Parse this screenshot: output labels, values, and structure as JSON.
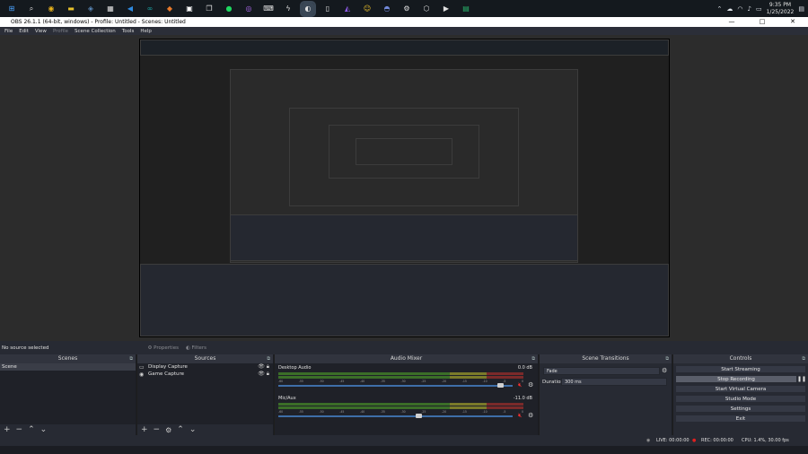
{
  "taskbar": {
    "icons": [
      "windows-icon",
      "search-icon",
      "chrome-icon",
      "file-explorer-icon",
      "steam-icon",
      "files-icon",
      "vscode-icon",
      "arduino-icon",
      "gamepad-icon",
      "notion-icon",
      "copy-icon",
      "spotify-icon",
      "github-icon",
      "keyboard-icon",
      "lightning-icon",
      "obs-icon",
      "notepad-icon",
      "visualstudio-icon",
      "emoji-icon",
      "discord-icon",
      "settings-icon",
      "cube-icon",
      "terminal-icon",
      "app-icon"
    ],
    "time": "9:35 PM",
    "date": "1/25/2022"
  },
  "window": {
    "title": "OBS 26.1.1 (64-bit, windows) - Profile: Untitled - Scenes: Untitled",
    "min": "—",
    "max": "□",
    "close": "✕"
  },
  "menu": [
    "File",
    "Edit",
    "View",
    "Profile",
    "Scene Collection",
    "Tools",
    "Help"
  ],
  "source_toolbar": {
    "status": "No source selected",
    "properties": "Properties",
    "filters": "Filters"
  },
  "scenes": {
    "title": "Scenes",
    "items": [
      "Scene"
    ]
  },
  "sources": {
    "title": "Sources",
    "items": [
      "Display Capture",
      "Game Capture"
    ]
  },
  "mixer": {
    "title": "Audio Mixer",
    "channels": [
      {
        "name": "Desktop Audio",
        "db": "0.0 dB",
        "level": 0.95
      },
      {
        "name": "Mic/Aux",
        "db": "-11.0 dB",
        "level": 0.6
      }
    ],
    "ticks": [
      "-60",
      "-55",
      "-50",
      "-45",
      "-40",
      "-35",
      "-30",
      "-25",
      "-20",
      "-15",
      "-10",
      "-5",
      "0"
    ]
  },
  "transitions": {
    "title": "Scene Transitions",
    "selected": "Fade",
    "duration_label": "Duration",
    "duration_value": "300 ms"
  },
  "controls": {
    "title": "Controls",
    "buttons": [
      "Start Streaming",
      "Stop Recording",
      "Start Virtual Camera",
      "Studio Mode",
      "Settings",
      "Exit"
    ],
    "active_index": 1
  },
  "status": {
    "live": "LIVE: 00:00:00",
    "rec": "REC: 00:00:00",
    "cpu": "CPU: 1.4%, 30.00 fps"
  }
}
